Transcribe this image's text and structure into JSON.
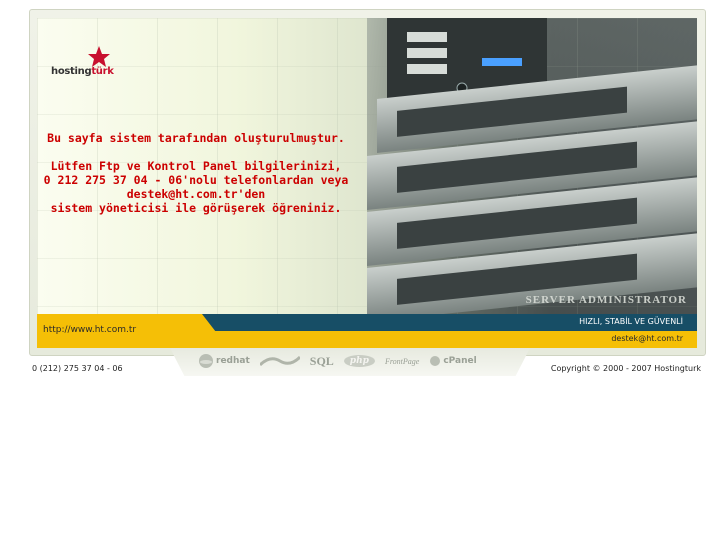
{
  "logo": {
    "brand_part1": "hosting",
    "brand_part2": "türk"
  },
  "message": {
    "line1": "Bu sayfa sistem tarafından oluşturulmuştur.",
    "line2": "Lütfen Ftp ve Kontrol Panel bilgilerinizi,",
    "line3": "0 212 275 37 04 - 06'nolu telefonlardan veya",
    "line4": "destek@ht.com.tr'den",
    "line5": "sistem yöneticisi ile görüşerek öğreniniz."
  },
  "hero": {
    "caption": "SERVER ADMINISTRATOR"
  },
  "bar": {
    "url": "http://www.ht.com.tr",
    "slogan": "HIZLI, STABİL VE GÜVENLİ",
    "email": "destek@ht.com.tr"
  },
  "tech_logos": {
    "redhat": "redhat",
    "sql": "SQL",
    "php": "php",
    "frontpage": "FrontPage",
    "cpanel": "cPanel"
  },
  "footer": {
    "phone": "0 (212) 275 37 04 - 06",
    "copyright": "Copyright © 2000 - 2007 Hostingturk"
  },
  "colors": {
    "accent_red": "#cc0000",
    "bar_yellow": "#f5bf06",
    "bar_blue": "#174e66"
  }
}
